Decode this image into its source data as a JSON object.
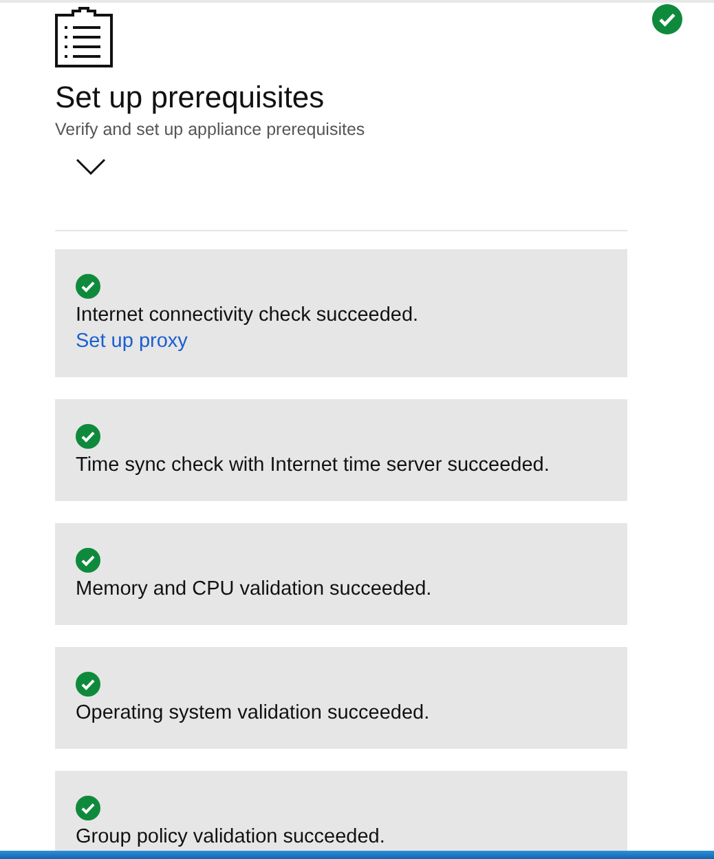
{
  "step": {
    "title": "Set up prerequisites",
    "subtitle": "Verify and set up appliance prerequisites",
    "passed": true,
    "expanded": true
  },
  "checks": [
    {
      "passed": true,
      "message": "Internet connectivity check succeeded.",
      "link": "Set up proxy"
    },
    {
      "passed": true,
      "message": "Time sync check with Internet time server succeeded."
    },
    {
      "passed": true,
      "message": "Memory and CPU validation succeeded."
    },
    {
      "passed": true,
      "message": "Operating system validation succeeded."
    },
    {
      "passed": true,
      "message": "Group policy validation succeeded."
    }
  ]
}
